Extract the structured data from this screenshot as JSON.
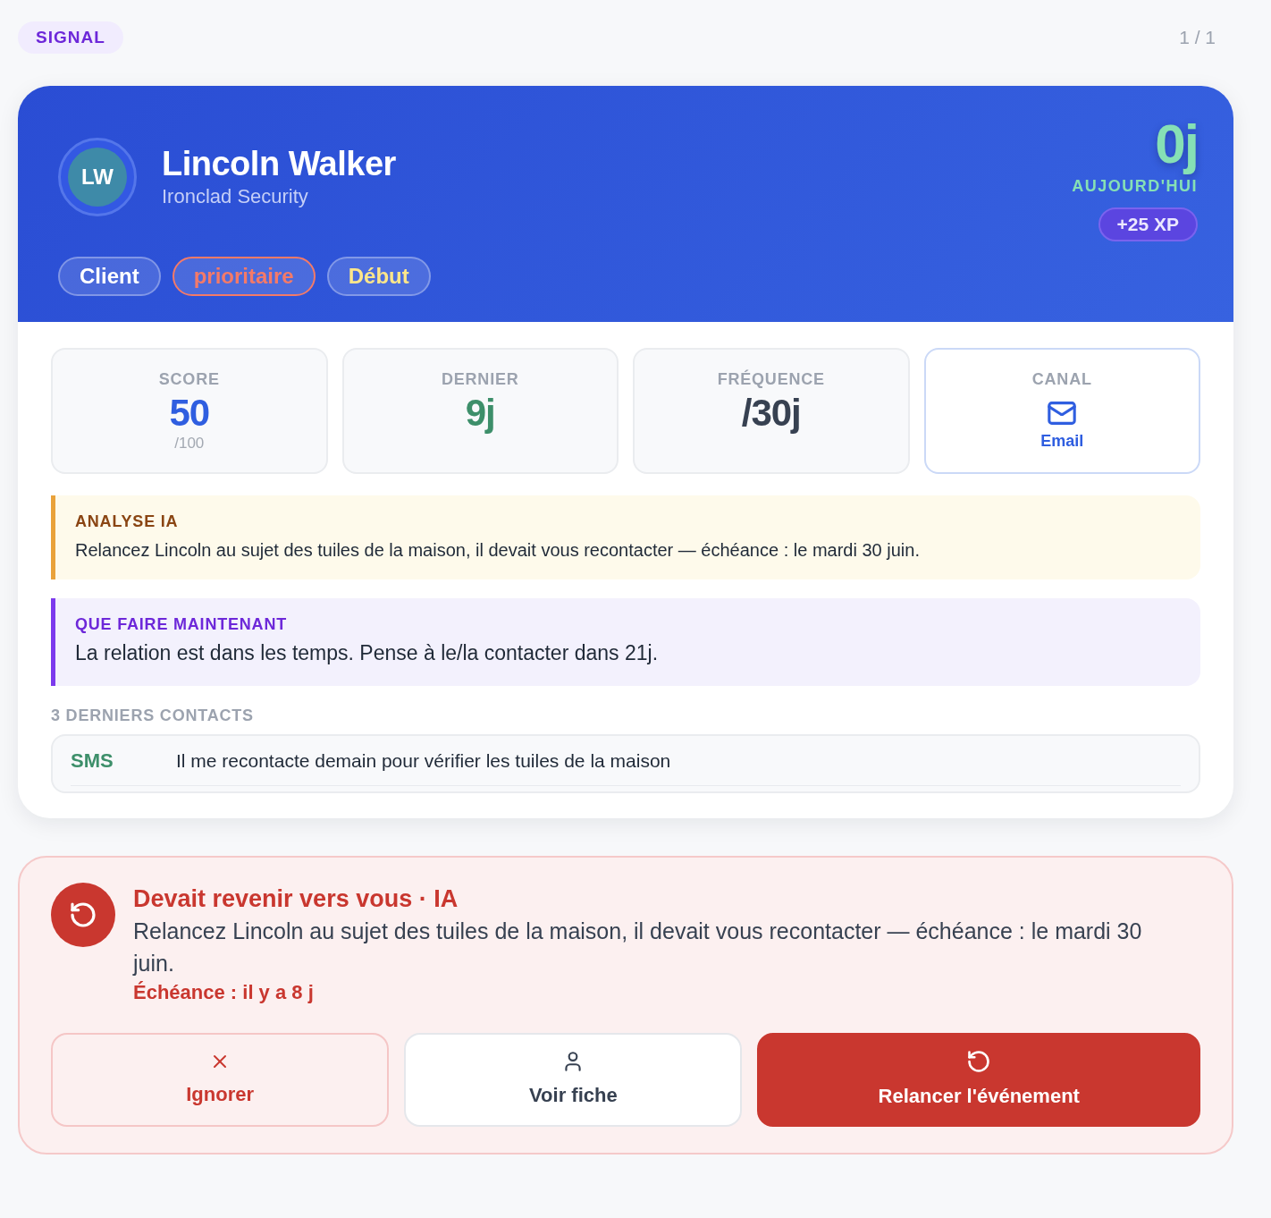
{
  "header": {
    "badge": "SIGNAL",
    "pager": "1 / 1"
  },
  "contact": {
    "initials": "LW",
    "name": "Lincoln Walker",
    "company": "Ironclad Security",
    "tags": [
      {
        "label": "Client",
        "color": "#ffffff",
        "kind": "plain"
      },
      {
        "label": "prioritaire",
        "color": "#f47a68",
        "kind": "outlined"
      },
      {
        "label": "Début",
        "color": "#fde68a",
        "kind": "plain"
      }
    ],
    "days": "0j",
    "days_label": "AUJOURD'HUI",
    "xp": "+25 XP"
  },
  "stats": [
    {
      "kind": "value",
      "label": "SCORE",
      "value": "50",
      "color": "#2f5ee0",
      "sub": "/100"
    },
    {
      "kind": "value",
      "label": "DERNIER",
      "value": "9j",
      "color": "#3d8f6a"
    },
    {
      "kind": "value",
      "label": "FRÉQUENCE",
      "value": "/30j",
      "color": "#374151"
    },
    {
      "kind": "channel",
      "label": "CANAL",
      "value": "Email",
      "color": "#2f5ee0"
    }
  ],
  "notes": [
    {
      "kind": "analysis",
      "title": "ANALYSE IA",
      "text": "Relancez Lincoln au sujet des tuiles de la maison, il devait vous recontacter — échéance : le mardi 30 juin."
    },
    {
      "kind": "action",
      "title": "QUE FAIRE MAINTENANT",
      "text": "La relation est dans les temps. Pense à le/la contacter dans 21j."
    }
  ],
  "contacts": {
    "title": "3 DERNIERS CONTACTS",
    "rows": [
      {
        "channel": "SMS",
        "text": "Il me recontacte demain pour vérifier les tuiles de la maison"
      }
    ]
  },
  "alert": {
    "title": "Devait revenir vers vous · IA",
    "text": "Relancez Lincoln au sujet des tuiles de la maison, il devait vous recontacter — échéance : le mardi 30 juin.",
    "due": "Échéance : il y a 8 j",
    "actions": [
      {
        "kind": "dismiss",
        "label": "Ignorer"
      },
      {
        "kind": "view",
        "label": "Voir fiche"
      },
      {
        "kind": "primary",
        "label": "Relancer l'événement"
      }
    ]
  }
}
